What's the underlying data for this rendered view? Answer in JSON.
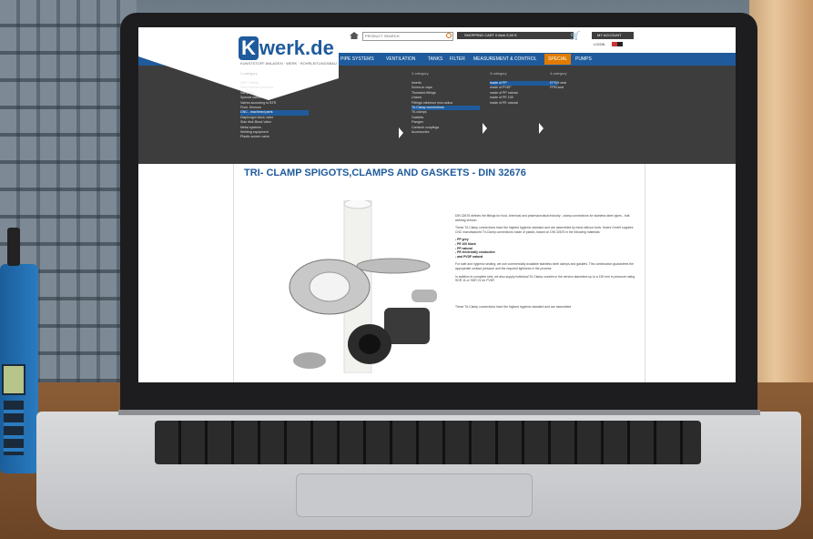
{
  "site": {
    "logo": {
      "mark": "K",
      "text": "werk.de",
      "tagline": "KUNSTSTOFF ANLAGEN · WERK · ROHRLEITUNGSBAU"
    },
    "search_placeholder": "PRODUCT SEARCH",
    "cart_label": "SHOPPING CART  0 Item 0,00 €",
    "account_label": "MY ACCOUNT",
    "login_label": "LOGIN",
    "nav": [
      "PIPE SYSTEMS",
      "VENTILATION",
      "TANKS",
      "FILTER",
      "MEASUREMENT & CONTROL",
      "SPECIAL",
      "PUMPS"
    ],
    "menu": {
      "col1": {
        "head": "1.category",
        "items": [
          "KMP Fittings",
          "Semi finished products",
          "Sampling",
          "Special valves",
          "Valves according to BTR",
          "Fluid, Sensors",
          "CNC - machined parts",
          "Diaphragm block valve",
          "Side disk Block Valve",
          "Metal systems",
          "Welding equipment",
          "Plastic screen valve"
        ],
        "highlight": 6
      },
      "col2": {
        "head": "2.category",
        "items": [
          "Inserts",
          "Screw-to caps",
          "Threaded fittings",
          "Unions",
          "Fittings minimum end-radius",
          "Tri-Clamp connections",
          "Tri-clamps",
          "Gaskets",
          "Flanges",
          "Camlock couplings",
          "Accessories"
        ],
        "highlight": 5
      },
      "col3": {
        "head": "3.category",
        "items": [
          "made of PP",
          "made of PVDF",
          "made of PP natural",
          "made of PE 100",
          "made of PE natural"
        ],
        "highlight": 0
      },
      "col4": {
        "head": "4.category",
        "items": [
          "EPDM seal",
          "FPM seal"
        ],
        "highlight": -1
      }
    },
    "page_title": "TRI- CLAMP SPIGOTS,CLAMPS AND GASKETS - DIN 32676",
    "body": {
      "p1": "DIN 32676 defines the fittings for food, chemical and pharmaceutical industry - clamp connections for stainless steel pipes - butt welding version.",
      "p2": "These Tri-Clamp connections have the highest hygienic standard and are assembled by bend without tools. Kwerk GmbH supplies CNC manufactured Tri-Clamp connections made of plastic, based on DIN 32676 in the following materials:",
      "list": [
        "- PP grey",
        "- PE 100 black",
        "- PP natural",
        "- PE electrically conductive",
        "- and PVDF natural"
      ],
      "p3": "For safe and hygienic sealing, we use commercially available stainless steel clamps and gaskets. This combination guarantees the appropriate contact pressure and the required tightness in the process.",
      "p4": "In addition to complete sets, we also supply individual Tri-Clamp nozzles in the version diameters up to a 150 mm in pressure rating SDR 11 or SDR 21 for PVDF.",
      "p5": "These Tri-Clamp connections have the highest hygienic standard and are assembled"
    }
  },
  "colors": {
    "brand": "#1f5b9c",
    "accent": "#e07b00",
    "menu_bg": "#3d3d3d"
  }
}
